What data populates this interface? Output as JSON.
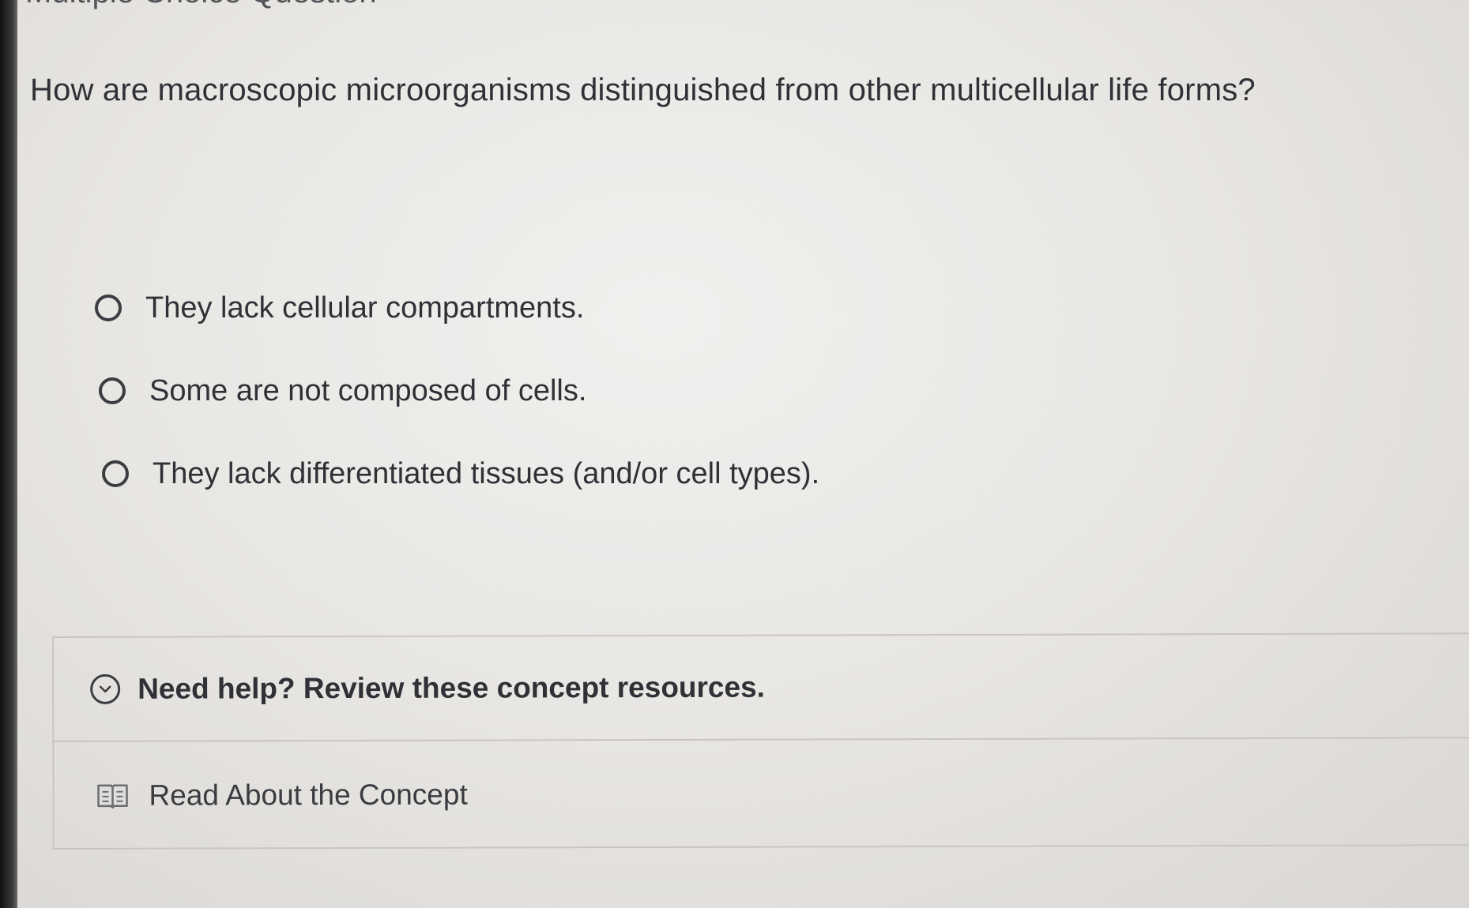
{
  "page": {
    "section_heading": "Multiple Choice Question"
  },
  "question": {
    "text": "How are macroscopic microorganisms distinguished from other multicellular life forms?",
    "options": [
      {
        "label": "They lack cellular compartments.",
        "selected": false
      },
      {
        "label": "Some are not composed of cells.",
        "selected": false
      },
      {
        "label": "They lack differentiated tissues (and/or cell types).",
        "selected": false
      }
    ]
  },
  "help": {
    "title": "Need help? Review these concept resources.",
    "expanded": true,
    "toggle_icon": "chevron-down-circle-icon",
    "resources": [
      {
        "label": "Read About the Concept",
        "icon": "book-icon"
      }
    ]
  }
}
